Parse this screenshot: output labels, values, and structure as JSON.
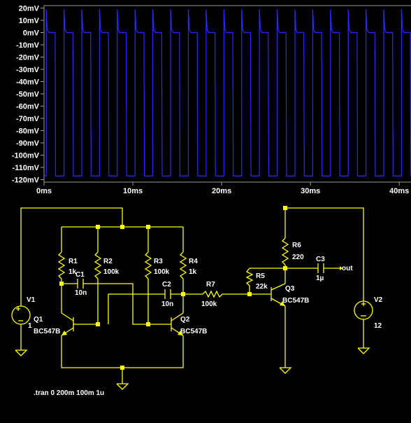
{
  "waveform": {
    "y_labels": [
      "20mV",
      "10mV",
      "0mV",
      "-10mV",
      "-20mV",
      "-30mV",
      "-40mV",
      "-50mV",
      "-60mV",
      "-70mV",
      "-80mV",
      "-90mV",
      "-100mV",
      "-110mV",
      "-120mV"
    ],
    "x_labels": [
      "0ms",
      "10ms",
      "20ms",
      "30ms",
      "40ms"
    ],
    "trace_color": "#2a2aff",
    "axis_color": "#9a9a9a",
    "label_color": "#ffffff"
  },
  "chart_data": {
    "type": "line",
    "title": "",
    "xlabel": "",
    "ylabel": "",
    "xlim": [
      0,
      42.5
    ],
    "ylim": [
      -122,
      22
    ],
    "x_unit": "ms",
    "y_unit": "mV",
    "series": [
      {
        "period_ms": 2.0,
        "high_mv": 0,
        "low_mv": -117,
        "spike_mv": 19,
        "duty": 0.5
      }
    ]
  },
  "schematic": {
    "wire_color": "#ffff00",
    "label_color": "#ffffff",
    "components": {
      "r1": {
        "name": "R1",
        "value": "1k"
      },
      "r2": {
        "name": "R2",
        "value": "100k"
      },
      "r3": {
        "name": "R3",
        "value": "100k"
      },
      "r4": {
        "name": "R4",
        "value": "1k"
      },
      "c1": {
        "name": "C1",
        "value": "10n"
      },
      "c2": {
        "name": "C2",
        "value": "10n"
      },
      "r7": {
        "name": "R7",
        "value": "100k"
      },
      "r5": {
        "name": "R5",
        "value": "22k"
      },
      "r6": {
        "name": "R6",
        "value": "220"
      },
      "c3": {
        "name": "C3",
        "value": "1µ"
      },
      "q1": {
        "name": "Q1",
        "value": "BC547B"
      },
      "q2": {
        "name": "Q2",
        "value": "BC547B"
      },
      "q3": {
        "name": "Q3",
        "value": "BC547B"
      },
      "v1": {
        "name": "V1",
        "value": "1"
      },
      "v2": {
        "name": "V2",
        "value": "12"
      }
    },
    "net_label_out": "out",
    "directive": ".tran 0 200m 100m 1u"
  }
}
